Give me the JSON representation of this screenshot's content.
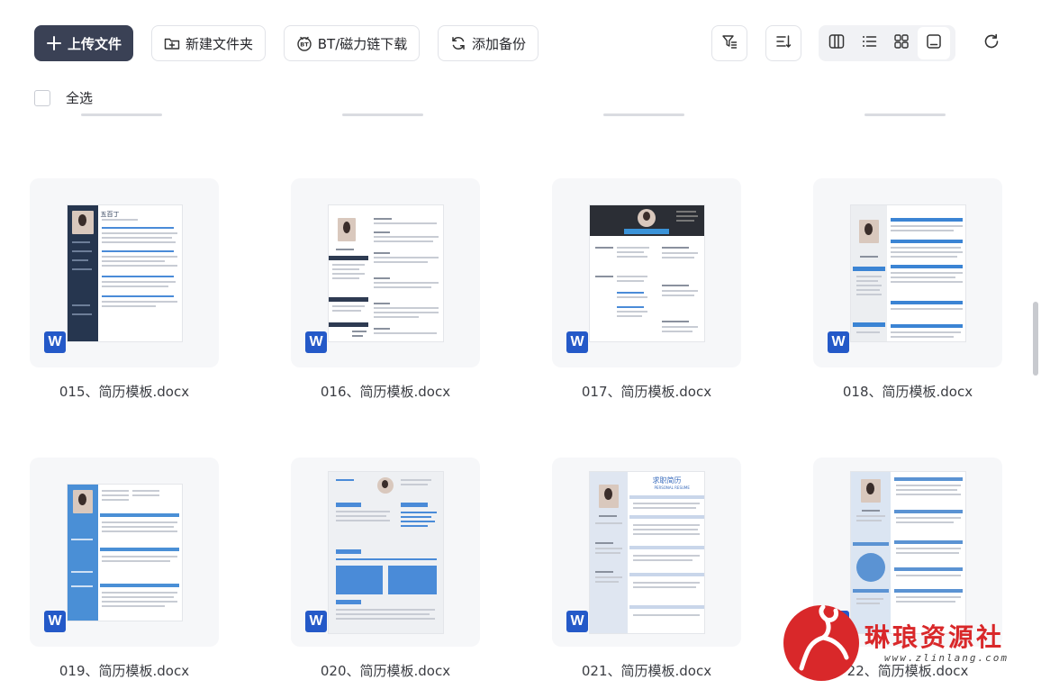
{
  "toolbar": {
    "upload_label": "上传文件",
    "new_folder_label": "新建文件夹",
    "bt_download_label": "BT/磁力链下载",
    "add_backup_label": "添加备份",
    "filter_icon": "filter-icon",
    "sort_icon": "sort-icon",
    "view_modes": [
      "columns-view",
      "list-view",
      "grid-view",
      "preview-view"
    ],
    "active_view": "preview-view",
    "refresh_icon": "refresh-icon"
  },
  "select_all": {
    "label": "全选",
    "checked": false
  },
  "files": [
    {
      "name": "015、简历模板.docx",
      "type": "word"
    },
    {
      "name": "016、简历模板.docx",
      "type": "word"
    },
    {
      "name": "017、简历模板.docx",
      "type": "word"
    },
    {
      "name": "018、简历模板.docx",
      "type": "word"
    },
    {
      "name": "019、简历模板.docx",
      "type": "word"
    },
    {
      "name": "020、简历模板.docx",
      "type": "word"
    },
    {
      "name": "021、简历模板.docx",
      "type": "word"
    },
    {
      "name": "22、简历模板.docx",
      "type": "word"
    }
  ],
  "badge_letter": "W",
  "thumbnails": {
    "t15_name": "五百丁",
    "t21_title": "求职简历",
    "t21_sub": "PERSONAL RESUME"
  },
  "watermark": {
    "text": "琳琅资源社",
    "url": "www.zlinlang.com"
  },
  "colors": {
    "primary_button": "#3a4155",
    "word_blue": "#2459c8",
    "watermark_red": "#d9282a"
  }
}
